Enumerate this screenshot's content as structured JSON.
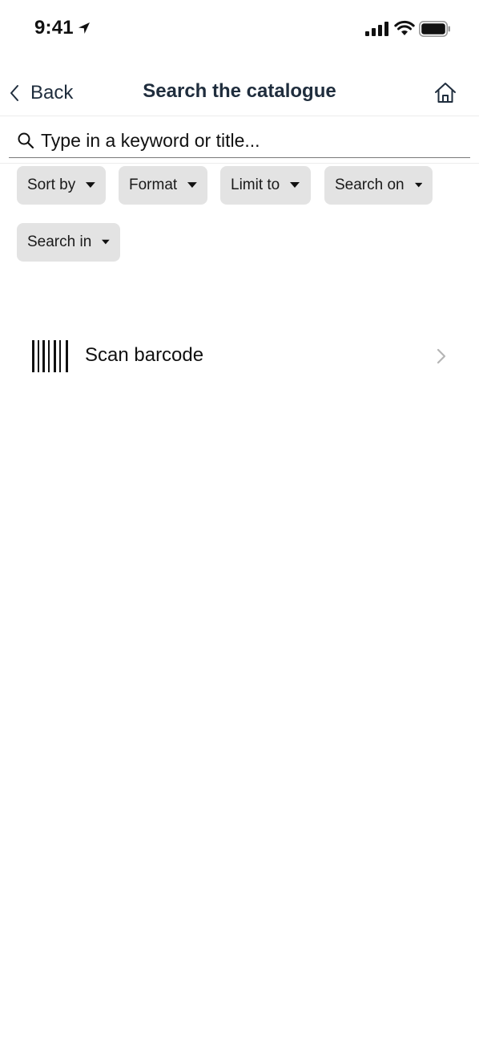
{
  "status_bar": {
    "time": "9:41",
    "icons": [
      "location-arrow-icon",
      "cellular-signal-icon",
      "wifi-icon",
      "battery-icon"
    ]
  },
  "nav": {
    "back_label": "Back",
    "title": "Search the catalogue",
    "home_icon": "home-icon"
  },
  "search": {
    "placeholder": "Type in a keyword or title...",
    "value": ""
  },
  "filters": [
    {
      "label": "Sort by"
    },
    {
      "label": "Format"
    },
    {
      "label": "Limit to"
    },
    {
      "label": "Search on"
    },
    {
      "label": "Search in"
    }
  ],
  "scan": {
    "label": "Scan barcode",
    "icon": "barcode-icon"
  },
  "colors": {
    "text": "#1f2d3d",
    "chip_bg": "#e3e3e3",
    "divider": "#ececec",
    "chevron": "#b5b5b5"
  }
}
